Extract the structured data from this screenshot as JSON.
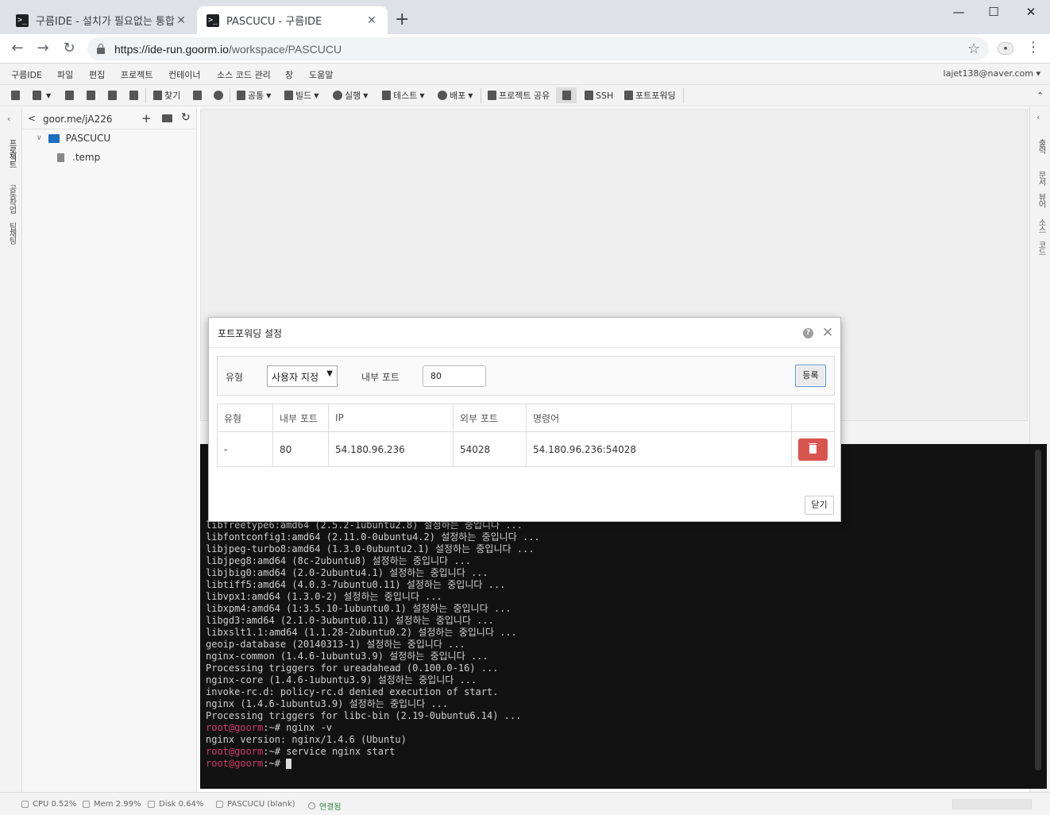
{
  "browser": {
    "tabs": [
      {
        "title": "구름IDE - 설치가 필요없는 통합",
        "active": false
      },
      {
        "title": "PASCUCU - 구름IDE",
        "active": true
      }
    ],
    "url_prefix": "https://ide-run.goorm.io",
    "url_path": "/workspace/PASCUCU",
    "window_buttons": [
      "minimize",
      "maximize",
      "close"
    ]
  },
  "menu": {
    "items": [
      "구름IDE",
      "파일",
      "편집",
      "프로젝트",
      "컨테이너",
      "소스 코드 관리",
      "창",
      "도움말"
    ],
    "user": "lajet138@naver.com"
  },
  "toolbar": {
    "find": "찾기",
    "common": "공통",
    "build": "빌드",
    "run": "실행",
    "test": "테스트",
    "deploy": "배포",
    "share": "프로젝트 공유",
    "ssh": "SSH",
    "port_forward": "포트포워딩"
  },
  "left_rail": {
    "tabs": [
      "프로젝트",
      "공동작업",
      "팀채팅"
    ]
  },
  "right_rail": {
    "tabs": [
      "출력",
      "문서 뷰어",
      "소스 코드"
    ]
  },
  "sidebar": {
    "path": "goor.me/jA226",
    "project": "PASCUCU",
    "file": ".temp"
  },
  "terminal": {
    "lines": [
      {
        "text": "libfreetype6:amd64 (2.5.2-1ubuntu2.8) 설정하는 중입니다 ..."
      },
      {
        "text": "libfontconfig1:amd64 (2.11.0-0ubuntu4.2) 설정하는 중입니다 ..."
      },
      {
        "text": "libjpeg-turbo8:amd64 (1.3.0-0ubuntu2.1) 설정하는 중입니다 ..."
      },
      {
        "text": "libjpeg8:amd64 (8c-2ubuntu8) 설정하는 중입니다 ..."
      },
      {
        "text": "libjbig0:amd64 (2.0-2ubuntu4.1) 설정하는 중입니다 ..."
      },
      {
        "text": "libtiff5:amd64 (4.0.3-7ubuntu0.11) 설정하는 중입니다 ..."
      },
      {
        "text": "libvpx1:amd64 (1.3.0-2) 설정하는 중입니다 ..."
      },
      {
        "text": "libxpm4:amd64 (1:3.5.10-1ubuntu0.1) 설정하는 중입니다 ..."
      },
      {
        "text": "libgd3:amd64 (2.1.0-3ubuntu0.11) 설정하는 중입니다 ..."
      },
      {
        "text": "libxslt1.1:amd64 (1.1.28-2ubuntu0.2) 설정하는 중입니다 ..."
      },
      {
        "text": "geoip-database (20140313-1) 설정하는 중입니다 ..."
      },
      {
        "text": "nginx-common (1.4.6-1ubuntu3.9) 설정하는 중입니다 ..."
      },
      {
        "text": "Processing triggers for ureadahead (0.100.0-16) ..."
      },
      {
        "text": "nginx-core (1.4.6-1ubuntu3.9) 설정하는 중입니다 ..."
      },
      {
        "text": "invoke-rc.d: policy-rc.d denied execution of start."
      },
      {
        "text": "nginx (1.4.6-1ubuntu3.9) 설정하는 중입니다 ..."
      },
      {
        "text": "Processing triggers for libc-bin (2.19-0ubuntu6.14) ..."
      },
      {
        "prompt": "root@goorm",
        "rest": ":~# nginx -v"
      },
      {
        "text": "nginx version: nginx/1.4.6 (Ubuntu)"
      },
      {
        "prompt": "root@goorm",
        "rest": ":~# service nginx start"
      },
      {
        "prompt": "root@goorm",
        "rest": ":~# ",
        "cursor": true
      }
    ],
    "prompt_color": "#d23b6b"
  },
  "statusbar": {
    "cpu": "CPU 0.52%",
    "mem": "Mem 2.99%",
    "disk": "Disk 0.64%",
    "container": "PASCUCU (blank)",
    "connection": "연결됨"
  },
  "dialog": {
    "title": "포트포워딩 설정",
    "type_label": "유형",
    "type_value": "사용자 지정",
    "internal_port_label": "내부 포트",
    "internal_port_value": "80",
    "register_button": "등록",
    "table": {
      "headers": [
        "유형",
        "내부 포트",
        "IP",
        "외부 포트",
        "명령어",
        ""
      ],
      "rows": [
        {
          "type": "-",
          "internal": "80",
          "ip": "54.180.96.236",
          "external": "54028",
          "command": "54.180.96.236:54028"
        }
      ]
    },
    "close_button": "닫기",
    "delete_color": "#d9534f"
  }
}
